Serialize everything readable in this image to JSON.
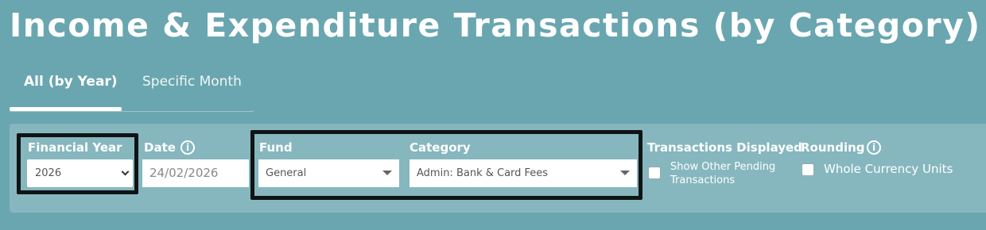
{
  "header": {
    "title": "Income & Expenditure Transactions (by Category)"
  },
  "tabs": [
    {
      "label": "All (by Year)",
      "active": true
    },
    {
      "label": "Specific Month",
      "active": false
    }
  ],
  "filters": {
    "financial_year": {
      "label": "Financial Year",
      "value": "2026"
    },
    "date": {
      "label": "Date",
      "value": "24/02/2026",
      "info_icon": "info-icon"
    },
    "fund": {
      "label": "Fund",
      "value": "General"
    },
    "category": {
      "label": "Category",
      "value": "Admin: Bank & Card Fees"
    },
    "transactions_displayed": {
      "label": "Transactions Displayed",
      "checkbox_label_line1": "Show Other Pending",
      "checkbox_label_line2": "Transactions",
      "checked": false
    },
    "rounding": {
      "label": "Rounding",
      "checkbox_label": "Whole Currency Units",
      "checked": false,
      "info_icon": "info-icon"
    }
  },
  "colors": {
    "background": "#6aa6b0",
    "panel": "#86b7bf",
    "highlight": "#0f1414",
    "text": "#ffffff"
  }
}
